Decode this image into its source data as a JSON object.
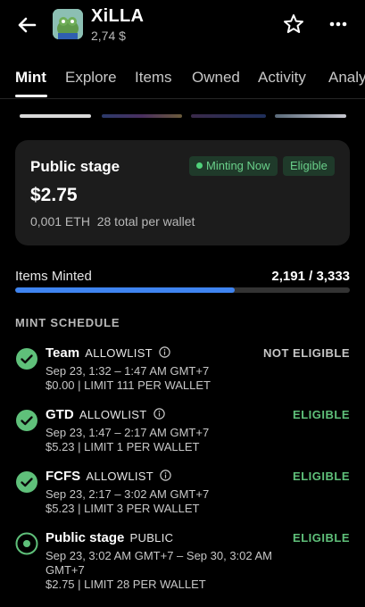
{
  "header": {
    "title": "XiLLA",
    "price": "2,74 $"
  },
  "tabs": [
    {
      "label": "Mint",
      "active": true
    },
    {
      "label": "Explore"
    },
    {
      "label": "Items"
    },
    {
      "label": "Owned"
    },
    {
      "label": "Activity"
    },
    {
      "label": "Analy"
    }
  ],
  "stage_card": {
    "title": "Public stage",
    "status_badge": "Minting Now",
    "eligibility_badge": "Eligible",
    "price": "$2.75",
    "eth_price": "0,001 ETH",
    "wallet_limit": "28 total per wallet"
  },
  "minted": {
    "label": "Items Minted",
    "count_text": "2,191 / 3,333",
    "progress_fraction": 0.657
  },
  "schedule": {
    "heading": "MINT SCHEDULE",
    "stages": [
      {
        "name": "Team",
        "tag": "ALLOWLIST",
        "has_info": true,
        "dates": "Sep 23, 1:32 – 1:47 AM GMT+7",
        "dates_cont": "",
        "limit": "$0.00 | LIMIT 111 PER WALLET",
        "eligibility": "NOT ELIGIBLE",
        "status": "done"
      },
      {
        "name": "GTD",
        "tag": "ALLOWLIST",
        "has_info": true,
        "dates": "Sep 23, 1:47 – 2:17 AM GMT+7",
        "dates_cont": "",
        "limit": "$5.23 | LIMIT 1 PER WALLET",
        "eligibility": "ELIGIBLE",
        "status": "done"
      },
      {
        "name": "FCFS",
        "tag": "ALLOWLIST",
        "has_info": true,
        "dates": "Sep 23, 2:17 – 3:02 AM GMT+7",
        "dates_cont": "",
        "limit": "$5.23 | LIMIT 3 PER WALLET",
        "eligibility": "ELIGIBLE",
        "status": "done"
      },
      {
        "name": "Public stage",
        "tag": "PUBLIC",
        "has_info": false,
        "dates": "Sep 23, 3:02 AM GMT+7 – Sep 30, 3:02 AM",
        "dates_cont": "GMT+7",
        "limit": "$2.75 | LIMIT 28 PER WALLET",
        "eligibility": "ELIGIBLE",
        "status": "active"
      }
    ]
  },
  "colors": {
    "accent_green": "#5fc07a",
    "progress_blue": "#3f84f0",
    "card_bg": "#1c1c1c"
  },
  "icons": [
    "back-arrow-icon",
    "star-icon",
    "more-icon",
    "info-icon",
    "check-circle-icon",
    "active-circle-icon"
  ]
}
